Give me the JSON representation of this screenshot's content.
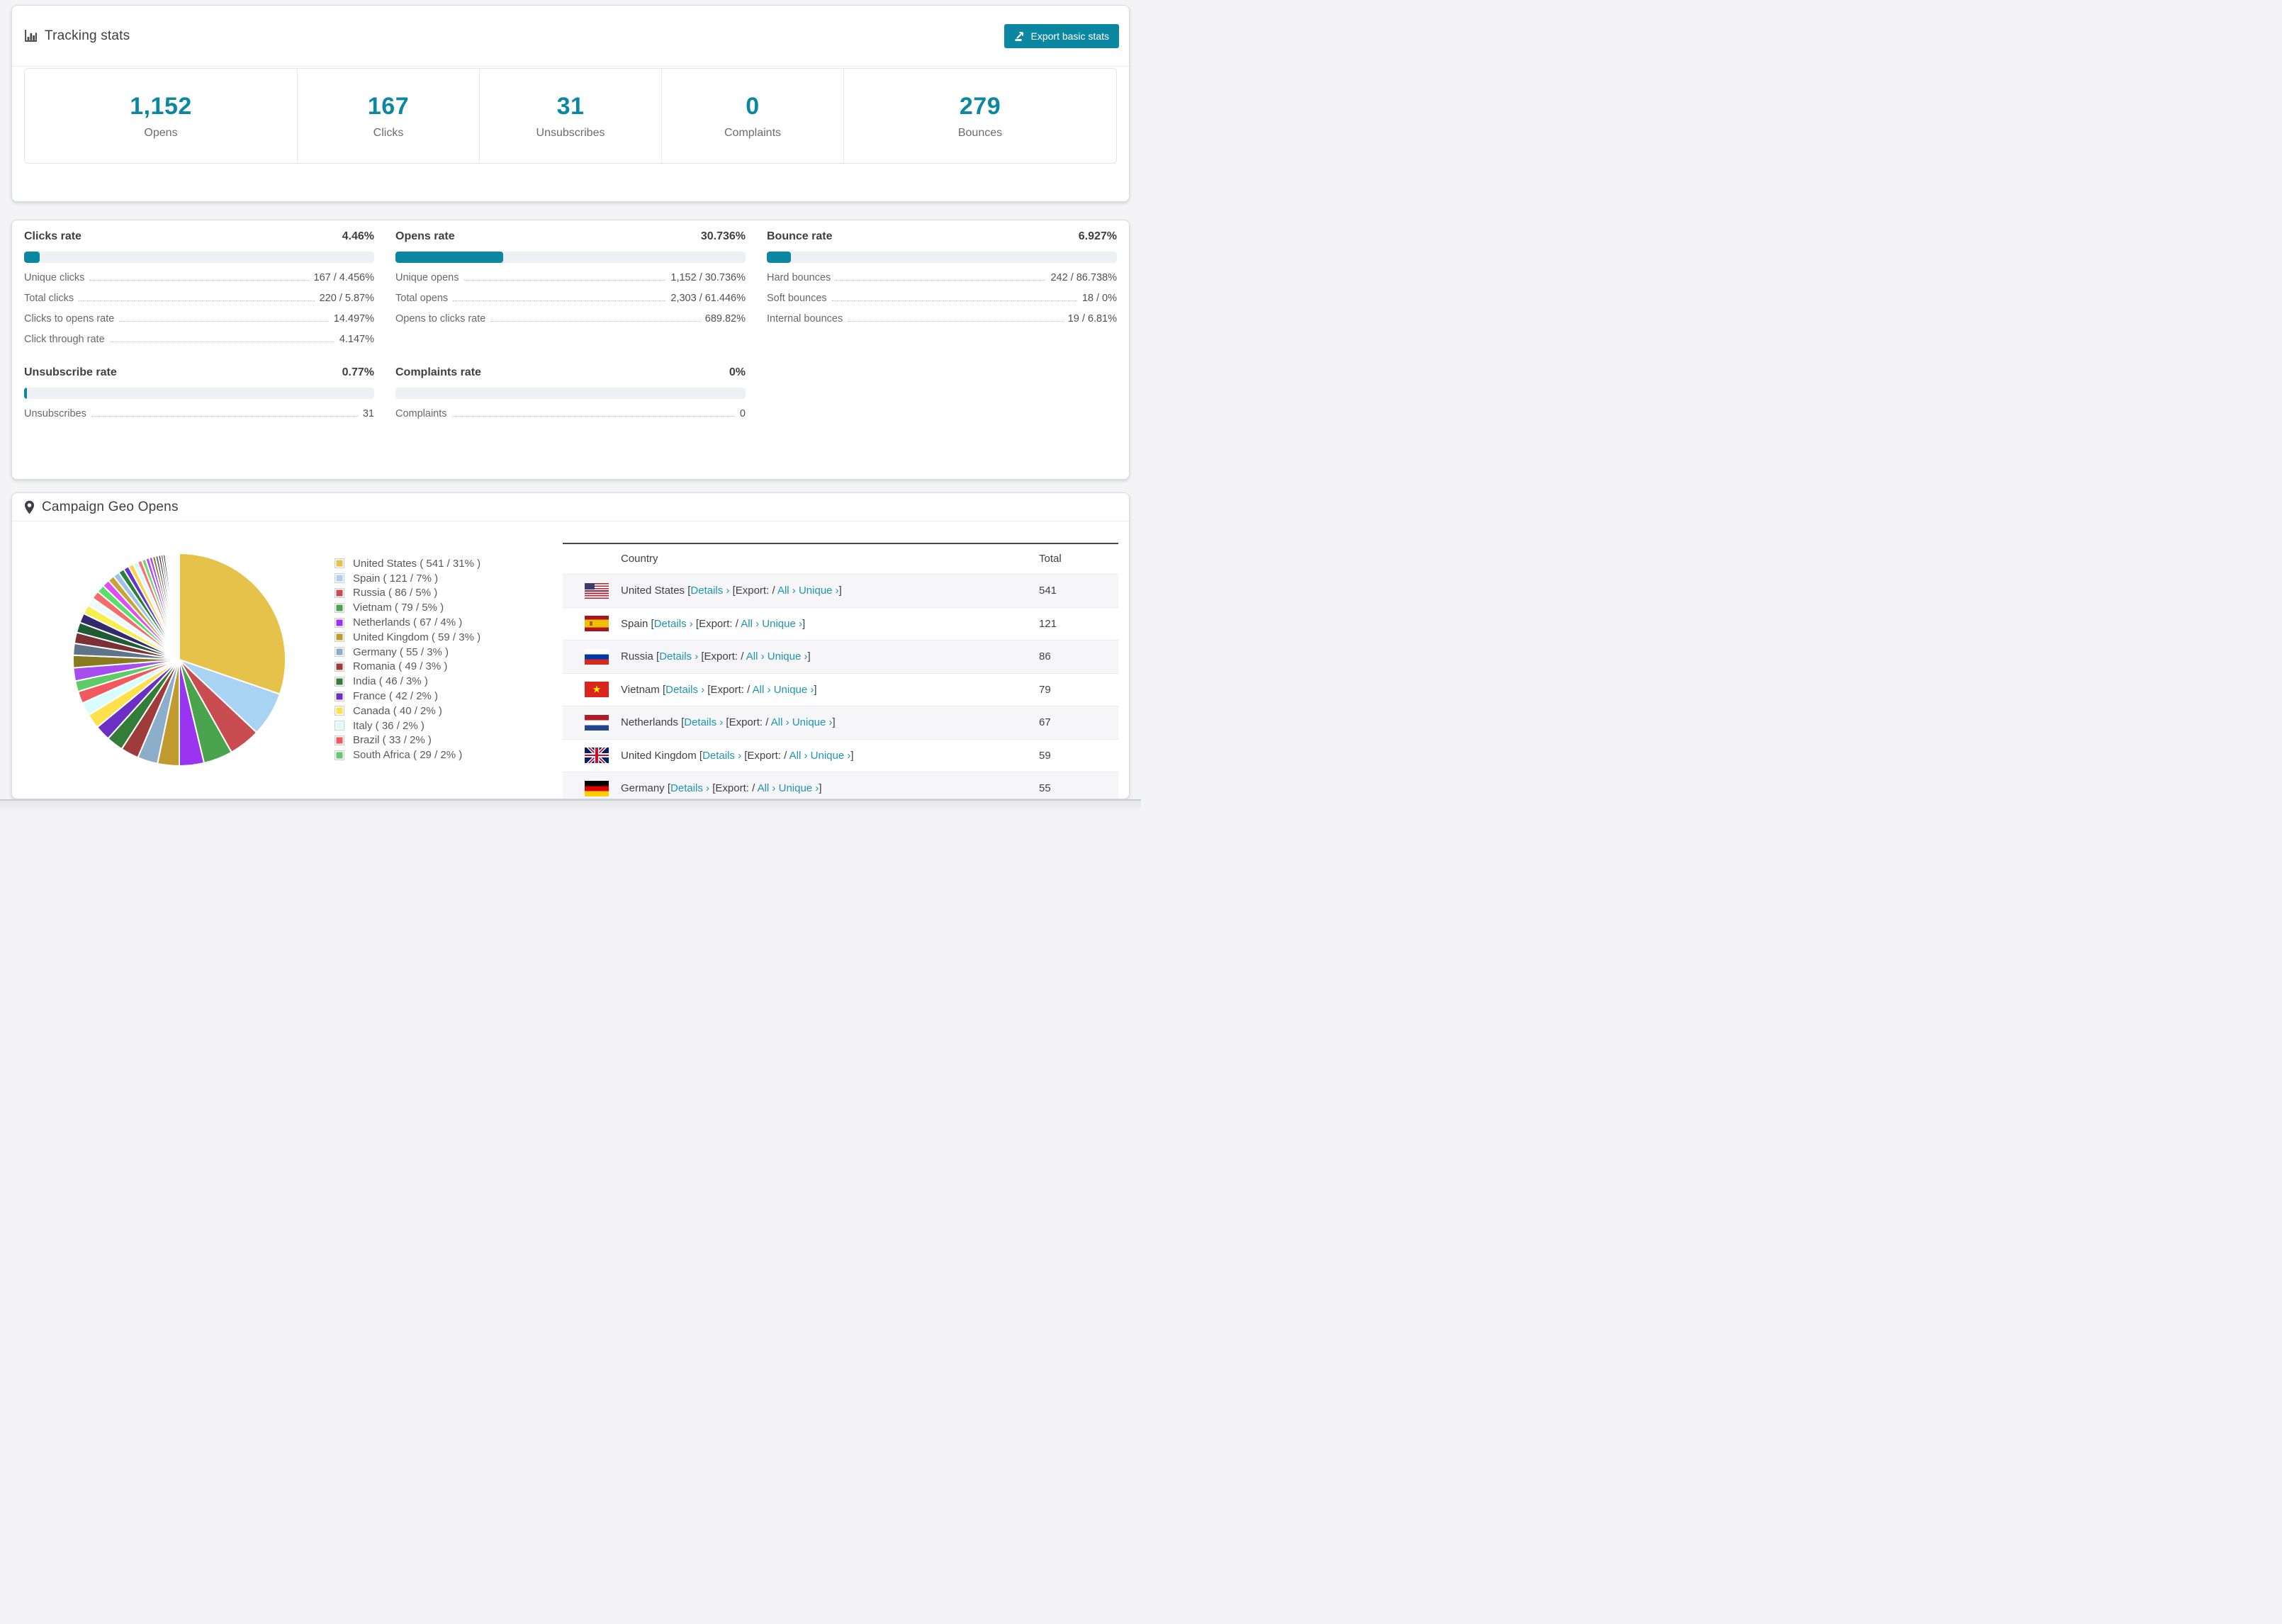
{
  "page": {
    "accent_color": "#0b87a2",
    "link_color": "#1e94b4"
  },
  "tracking": {
    "title": "Tracking stats",
    "export_button": "Export basic stats",
    "summary": [
      {
        "value": "1,152",
        "label": "Opens"
      },
      {
        "value": "167",
        "label": "Clicks"
      },
      {
        "value": "31",
        "label": "Unsubscribes"
      },
      {
        "value": "0",
        "label": "Complaints"
      },
      {
        "value": "279",
        "label": "Bounces"
      }
    ]
  },
  "rates": [
    {
      "title": "Clicks rate",
      "value": "4.46%",
      "percent": 4.46,
      "rows": [
        {
          "label": "Unique clicks",
          "value": "167 / 4.456%"
        },
        {
          "label": "Total clicks",
          "value": "220 / 5.87%"
        },
        {
          "label": "Clicks to opens rate",
          "value": "14.497%"
        },
        {
          "label": "Click through rate",
          "value": "4.147%"
        }
      ]
    },
    {
      "title": "Opens rate",
      "value": "30.736%",
      "percent": 30.736,
      "rows": [
        {
          "label": "Unique opens",
          "value": "1,152 / 30.736%"
        },
        {
          "label": "Total opens",
          "value": "2,303 / 61.446%"
        },
        {
          "label": "Opens to clicks rate",
          "value": "689.82%"
        }
      ]
    },
    {
      "title": "Bounce rate",
      "value": "6.927%",
      "percent": 6.927,
      "rows": [
        {
          "label": "Hard bounces",
          "value": "242 / 86.738%"
        },
        {
          "label": "Soft bounces",
          "value": "18 / 0%"
        },
        {
          "label": "Internal bounces",
          "value": "19 / 6.81%"
        }
      ]
    },
    {
      "title": "Unsubscribe rate",
      "value": "0.77%",
      "percent": 0.77,
      "rows": [
        {
          "label": "Unsubscribes",
          "value": "31"
        }
      ]
    },
    {
      "title": "Complaints rate",
      "value": "0%",
      "percent": 0,
      "rows": [
        {
          "label": "Complaints",
          "value": "0"
        }
      ]
    }
  ],
  "geo": {
    "title": "Campaign Geo Opens",
    "table_headers": {
      "country": "Country",
      "total": "Total"
    },
    "link_labels": {
      "details": "Details ›",
      "export_prefix": "[Export:",
      "all": "All ›",
      "unique": "Unique ›",
      "slash": "/",
      "open": "[",
      "close": "]"
    },
    "rows": [
      {
        "country": "United States",
        "flag": "us",
        "total": "541"
      },
      {
        "country": "Spain",
        "flag": "es",
        "total": "121"
      },
      {
        "country": "Russia",
        "flag": "ru",
        "total": "86"
      },
      {
        "country": "Vietnam",
        "flag": "vn",
        "total": "79"
      },
      {
        "country": "Netherlands",
        "flag": "nl",
        "total": "67"
      },
      {
        "country": "United Kingdom",
        "flag": "gb",
        "total": "59"
      },
      {
        "country": "Germany",
        "flag": "de",
        "total": "55"
      }
    ]
  },
  "chart_data": {
    "type": "pie",
    "title": "Campaign Geo Opens",
    "legend_position": "right",
    "start_angle_deg": -90,
    "direction": "clockwise",
    "labels": [
      "United States",
      "Spain",
      "Russia",
      "Vietnam",
      "Netherlands",
      "United Kingdom",
      "Germany",
      "Romania",
      "India",
      "France",
      "Canada",
      "Italy",
      "Brazil",
      "South Africa"
    ],
    "values": [
      541,
      121,
      86,
      79,
      67,
      59,
      55,
      49,
      46,
      42,
      40,
      36,
      33,
      29
    ],
    "percents": [
      31,
      7,
      5,
      5,
      4,
      3,
      3,
      3,
      3,
      2,
      2,
      2,
      2,
      2
    ],
    "colors": [
      "#e6c24a",
      "#a9d3f2",
      "#c84c50",
      "#4aa34d",
      "#9a34f0",
      "#c09b2f",
      "#8caecb",
      "#a03b3b",
      "#337d38",
      "#6b2fc4",
      "#fce14d",
      "#d9fcfc",
      "#f2595f",
      "#5ecb68"
    ],
    "legend_labels": [
      "United States ( 541 / 31% )",
      "Spain ( 121 / 7% )",
      "Russia ( 86 / 5% )",
      "Vietnam ( 79 / 5% )",
      "Netherlands ( 67 / 4% )",
      "United Kingdom ( 59 / 3% )",
      "Germany ( 55 / 3% )",
      "Romania ( 49 / 3% )",
      "India ( 46 / 3% )",
      "France ( 42 / 2% )",
      "Canada ( 40 / 2% )",
      "Italy ( 36 / 2% )",
      "Brazil ( 33 / 2% )",
      "South Africa ( 29 / 2% )"
    ],
    "others_note": "remaining slices are many small unlabeled countries (~26% combined)",
    "others_values": [
      36,
      34,
      32,
      30,
      28,
      26,
      25,
      23,
      22,
      21,
      20,
      18,
      17,
      16,
      15,
      14,
      13,
      12,
      11,
      10,
      9,
      8,
      8,
      7,
      6,
      6,
      5,
      5,
      4,
      4,
      3,
      3,
      3,
      2,
      2,
      2,
      2,
      1,
      1,
      1
    ],
    "others_palette": [
      "#a64df0",
      "#8a7a1e",
      "#5f7488",
      "#7c3136",
      "#1f5c35",
      "#332a6e",
      "#f7ef4e",
      "#eef9ff",
      "#f56a6a",
      "#58e06a",
      "#df4ef0",
      "#caa23a",
      "#9fc3e0",
      "#2a8040",
      "#6633cc",
      "#ffd24d",
      "#d8fbff",
      "#ff7070",
      "#70d870",
      "#b34df0"
    ]
  }
}
